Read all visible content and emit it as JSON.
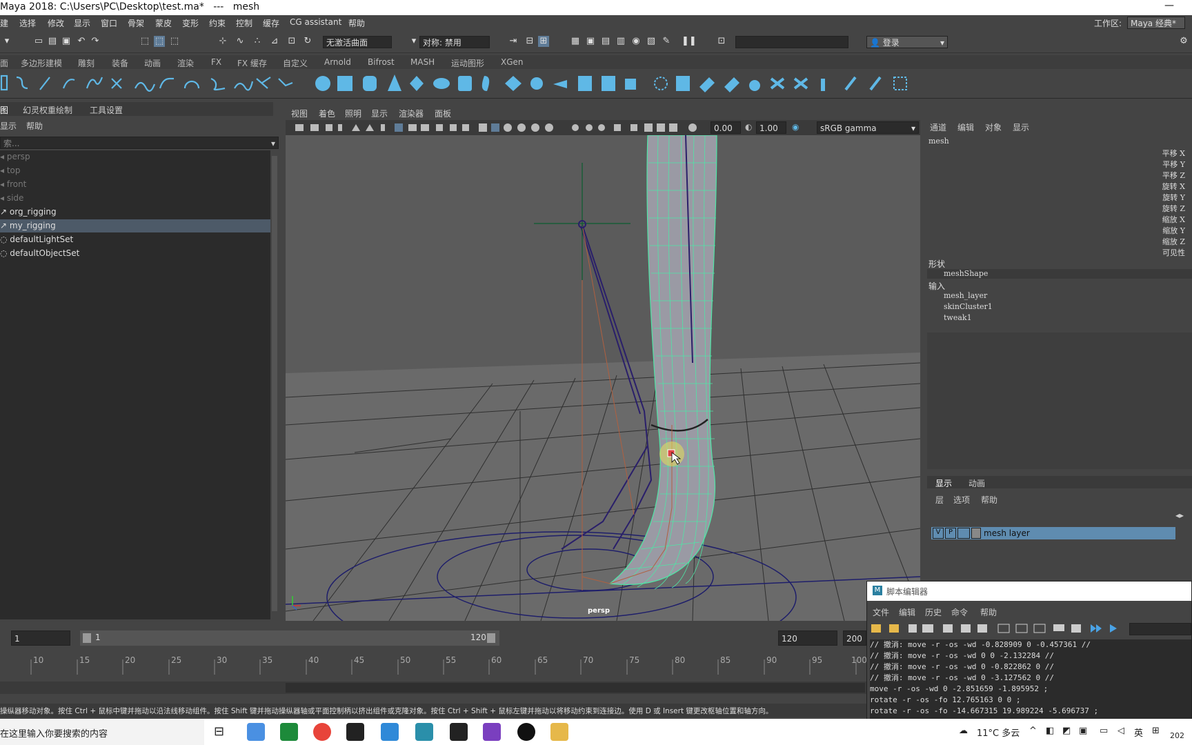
{
  "window": {
    "title": "Maya 2018: C:\\Users\\PC\\Desktop\\test.ma*   ---   mesh"
  },
  "menu": {
    "items": [
      "建",
      "选择",
      "修改",
      "显示",
      "窗口",
      "骨架",
      "蒙皮",
      "变形",
      "约束",
      "控制",
      "缓存",
      "CG assistant",
      "帮助"
    ],
    "workspace_label": "工作区:",
    "workspace_value": "Maya 经典*"
  },
  "toolbar": {
    "live_surface": "无激活曲面",
    "symmetry": "对称: 禁用",
    "login": "登录"
  },
  "shelf": {
    "tabs": [
      "面",
      "多边形建模",
      "雕刻",
      "装备",
      "动画",
      "渲染",
      "FX",
      "FX 缓存",
      "自定义",
      "Arnold",
      "Bifrost",
      "MASH",
      "运动图形",
      "XGen"
    ]
  },
  "outliner": {
    "tabs": [
      "图",
      "幻灵权重绘制",
      "工具设置"
    ],
    "menu": [
      "显示",
      "帮助"
    ],
    "search_placeholder": "索...",
    "items": [
      {
        "label": "persp",
        "dim": true
      },
      {
        "label": "top",
        "dim": true
      },
      {
        "label": "front",
        "dim": true
      },
      {
        "label": "side",
        "dim": true
      },
      {
        "label": "org_rigging",
        "dim": false
      },
      {
        "label": "my_rigging",
        "dim": false,
        "selected": true
      },
      {
        "label": "defaultLightSet",
        "dim": false
      },
      {
        "label": "defaultObjectSet",
        "dim": false
      }
    ]
  },
  "viewport": {
    "menu": [
      "视图",
      "着色",
      "照明",
      "显示",
      "渲染器",
      "面板"
    ],
    "exposure": "0.00",
    "gamma": "1.00",
    "colorspace": "sRGB gamma",
    "camera_label": "persp"
  },
  "channel_box": {
    "menu": [
      "通道",
      "编辑",
      "对象",
      "显示"
    ],
    "object": "mesh",
    "attributes": [
      "平移 X",
      "平移 Y",
      "平移 Z",
      "旋转 X",
      "旋转 Y",
      "旋转 Z",
      "缩放 X",
      "缩放 Y",
      "缩放 Z",
      "可见性"
    ],
    "shape_header": "形状",
    "shape": "meshShape",
    "input_header": "输入",
    "inputs": [
      "mesh_layer",
      "skinCluster1",
      "tweak1"
    ]
  },
  "layer_editor": {
    "tabs": [
      "显示",
      "动画"
    ],
    "menu": [
      "层",
      "选项",
      "帮助"
    ],
    "layer": {
      "v": "V",
      "p": "P",
      "name": "mesh layer"
    }
  },
  "time_range": {
    "start": "1",
    "range_start": "1",
    "range_end": "120",
    "end": "120",
    "end2": "200",
    "ticks": [
      "10",
      "15",
      "20",
      "25",
      "30",
      "35",
      "40",
      "45",
      "50",
      "55",
      "60",
      "65",
      "70",
      "75",
      "80",
      "85",
      "90",
      "95",
      "100"
    ]
  },
  "help_line": "操纵器移动对象。按住 Ctrl + 鼠标中键并拖动以沿法线移动组件。按住 Shift 键并拖动操纵器轴或平面控制柄以挤出组件或克隆对象。按住 Ctrl + Shift + 鼠标左键并拖动以将移动约束到连接边。使用 D 或 Insert 键更改枢轴位置和轴方向。",
  "script_editor": {
    "title": "脚本编辑器",
    "menu": [
      "文件",
      "编辑",
      "历史",
      "命令",
      "帮助"
    ],
    "lines": [
      "// 撤消: move -r -os -wd -0.828909 0 -0.457361  //",
      "// 撤消: move -r -os -wd 0 0 -2.132284  //",
      "// 撤消: move -r -os -wd 0 -0.822862 0  //",
      "// 撤消: move -r -os -wd 0 -3.127562 0  //",
      "move -r -os -wd 0 -2.851659 -1.895952 ;",
      "rotate -r -os -fo 12.765163 0 0 ;",
      "rotate -r -os -fo -14.667315 19.989224 -5.696737 ;"
    ]
  },
  "taskbar": {
    "search": "在这里输入你要搜索的内容",
    "weather": "11°C 多云",
    "ime": "英",
    "year": "202"
  }
}
